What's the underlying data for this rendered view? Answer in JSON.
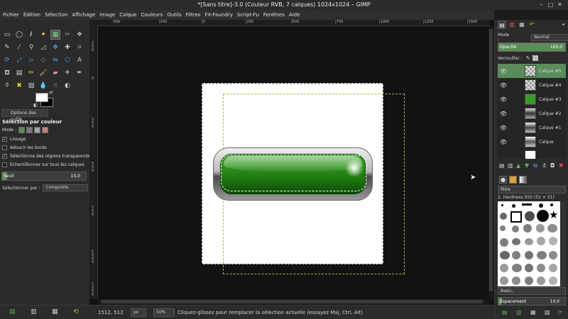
{
  "window": {
    "title": "*[Sans titre]-3.0 (Couleur RVB, 7 calques) 1024x1024 – GIMP",
    "minimize": "–",
    "maximize": "□",
    "close": "✕"
  },
  "menu": [
    "Fichier",
    "Édition",
    "Sélection",
    "Affichage",
    "Image",
    "Calque",
    "Couleurs",
    "Outils",
    "Filtres",
    "FX-Foundry",
    "Script-Fu",
    "Fenêtres",
    "Aide"
  ],
  "tool_options": {
    "tab_label": "Options des outils",
    "heading": "Sélection par couleur",
    "mode_label": "Mode :",
    "antialias": "Lissage",
    "feather": "Adoucir les bords",
    "transparent": "Sélectionne des régions transparentes",
    "sample_merged": "Échantillonner sur tous les calques",
    "threshold_label": "Seuil",
    "threshold_value": "15,0",
    "threshold_fraction": 0.06,
    "select_by_label": "Sélectionner par :",
    "select_by_value": "Composite"
  },
  "rulers": {
    "h": [
      "-500",
      "|250",
      "|0",
      "|250",
      "|500",
      "|750",
      "|1000",
      "|1250",
      "|1500"
    ],
    "v": [
      "2 5 0",
      "0",
      "2 5 0",
      "5 0 0",
      "7 5 0",
      "1 0 0 0",
      "1 2 5 0"
    ]
  },
  "status": {
    "coords": "1512, 512",
    "unit": "px",
    "zoom": "50%",
    "message": "Cliquez-glissez pour remplacer la sélection actuelle (essayez Maj, Ctrl, Alt)"
  },
  "layers_panel": {
    "mode_label": "Mode :",
    "mode_value": "Normal",
    "opacity_label": "Opacité",
    "opacity_value": "100,0",
    "lock_label": "Verrouiller :",
    "layers": [
      {
        "name": "Calque #5",
        "active": true
      },
      {
        "name": "Calque #4",
        "active": false
      },
      {
        "name": "Calque #3",
        "active": false
      },
      {
        "name": "Calque #2",
        "active": false
      },
      {
        "name": "Calque #1",
        "active": false
      },
      {
        "name": "Calque",
        "active": false
      }
    ]
  },
  "brushes_panel": {
    "filter_placeholder": "filtre",
    "brush_name": "2. Hardness 050 (51 × 51)",
    "set": "Basic,",
    "spacing_label": "Espacement",
    "spacing_value": "10,0",
    "spacing_fraction": 0.05
  },
  "colors": {
    "accent": "#5b8c5b",
    "foreground": "#ffffff",
    "background": "#000000"
  },
  "icons": {
    "eye": "eye-icon"
  }
}
